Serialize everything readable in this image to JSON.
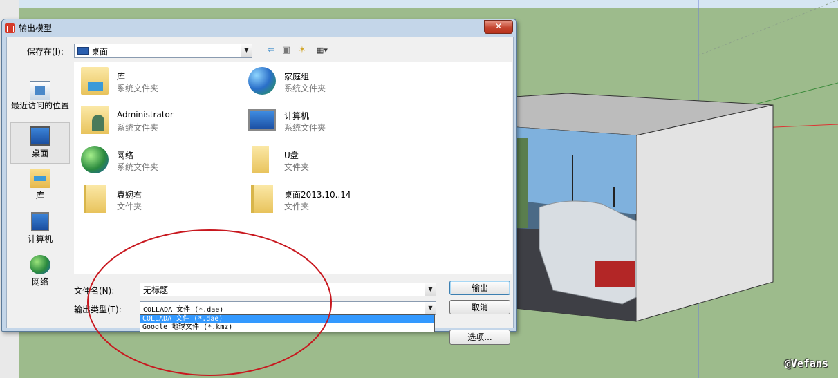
{
  "dialog": {
    "title": "输出模型",
    "close_glyph": "✕",
    "save_in_label": "保存在(I):",
    "save_in_value": "桌面",
    "combo_arrow": "▼",
    "tools": {
      "back": "⇦",
      "up": "▣",
      "new_folder": "✶",
      "view": "▦▾"
    }
  },
  "places": [
    {
      "label": "最近访问的位置",
      "icon": "recent-places-icon"
    },
    {
      "label": "桌面",
      "icon": "desktop-icon",
      "selected": true
    },
    {
      "label": "库",
      "icon": "library-icon"
    },
    {
      "label": "计算机",
      "icon": "computer-icon"
    },
    {
      "label": "网络",
      "icon": "network-icon"
    }
  ],
  "files": [
    {
      "name": "库",
      "type": "系统文件夹",
      "icon": "library-folder-icon"
    },
    {
      "name": "家庭组",
      "type": "系统文件夹",
      "icon": "homegroup-icon"
    },
    {
      "name": "Administrator",
      "type": "系统文件夹",
      "icon": "user-folder-icon"
    },
    {
      "name": "计算机",
      "type": "系统文件夹",
      "icon": "computer-icon"
    },
    {
      "name": "网络",
      "type": "系统文件夹",
      "icon": "network-icon"
    },
    {
      "name": "U盘",
      "type": "文件夹",
      "icon": "folder-icon"
    },
    {
      "name": "袁婉君",
      "type": "文件夹",
      "icon": "folder-icon"
    },
    {
      "name": "桌面2013.10..14",
      "type": "文件夹",
      "icon": "folder-icon"
    }
  ],
  "fields": {
    "filename_label": "文件名(N):",
    "filename_value": "无标题",
    "filetype_label": "输出类型(T):",
    "filetype_value": "COLLADA 文件 (*.dae)",
    "filetype_options": [
      "COLLADA 文件 (*.dae)",
      "Google 地球文件 (*.kmz)"
    ]
  },
  "buttons": {
    "export": "输出",
    "cancel": "取消",
    "options": "选项..."
  },
  "watermark": "@Vefans",
  "colors": {
    "annotation": "#c8171e",
    "highlight": "#3399ff",
    "ground": "#9dbb8c"
  }
}
